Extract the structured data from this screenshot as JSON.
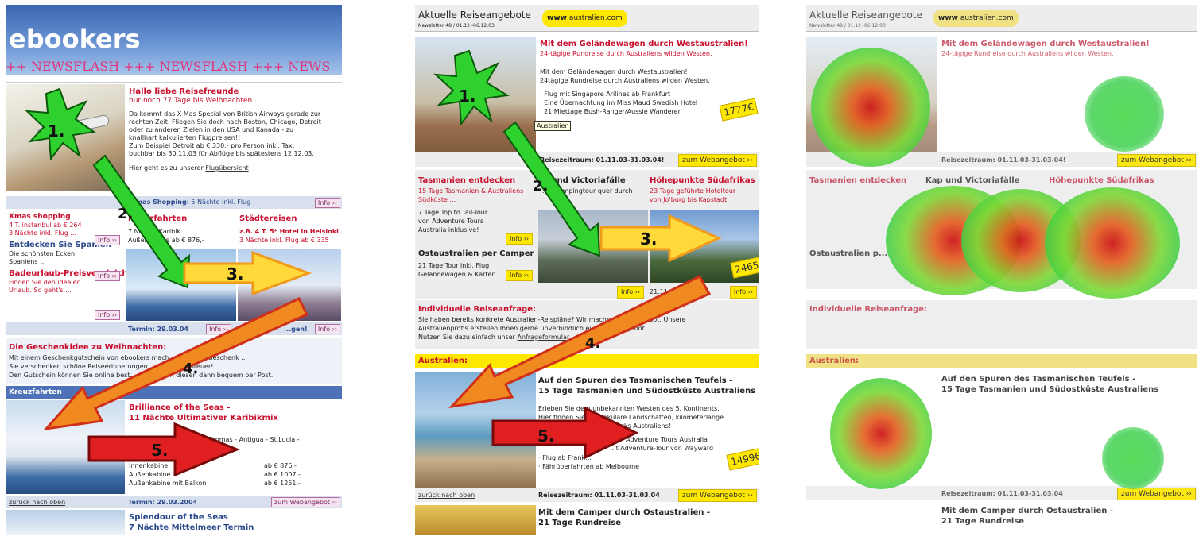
{
  "panel1": {
    "logo": "ebookers",
    "newsflash": "++ NEWSFLASH +++ NEWSFLASH +++ NEWS",
    "hero": {
      "title": "Hallo liebe Reisefreunde",
      "subtitle": "nur noch 77 Tage bis Weihnachten ...",
      "body": [
        "Da kommt das X-Mas Special von British Airways gerade zur",
        "rechten Zeit. Fliegen Sie doch nach Boston, Chicago, Detroit",
        "oder zu anderen Zielen in den USA und Kanada - zu",
        "knallhart kalkulierten Flugpreisen!!",
        "Zum Beispiel Detroit ab € 330,- pro Person inkl. Tax,",
        "buchbar bis 30.11.03 für Abflüge bis spätestens 12.12.03."
      ],
      "link_prefix": "Hier geht es zu unserer ",
      "link": "Flugübersicht"
    },
    "xmas_bar": {
      "label": "X-mas Shopping:",
      "text": " 5 Nächte inkl. Flug",
      "info": "Info ››"
    },
    "col1": [
      {
        "title": "Xmas shopping",
        "lines": [
          "4 T. instanbul ab € 264",
          "3 Nächte inkl. Flug ..."
        ],
        "info": "Info ››"
      },
      {
        "title": "Entdecken Sie Spanien",
        "lines": [
          "Die schönsten Ecken",
          "Spaniens ..."
        ],
        "info": "Info ››"
      },
      {
        "title": "Badeurlaub-Preisvergleich",
        "lines": [
          "Finden Sie den idealen",
          "Urlaub. So geht's ..."
        ],
        "info": "Info ››"
      }
    ],
    "col2": {
      "title": "Kreuzfahrten",
      "line1": "7 Nächte Karibik",
      "line2": "Außenkabine ab € 876,-"
    },
    "col3": {
      "title": "Städtereisen",
      "line1": "z.B. 4 T. 5* Hotel in Helsinki",
      "line2": "3 Nächte inkl. Flug ab € 335"
    },
    "termin_bar": {
      "termin": "Termin: 29.03.04",
      "info1": "Info ››",
      "text2": "Te...",
      "text3": "...gen!",
      "info2": "Info ››"
    },
    "gift": {
      "title": "Die Geschenkidee zu Weihnachten:",
      "lines": [
        "Mit einem Geschenkgutschein von ebookers mach... ...nur ein Geschenk ...",
        "Sie verschenken schöne Reiseerinnerungen ... ... ein Abenteuer!",
        "Den Gutschein können Sie online best... ...ersenden diesen dann bequem per Post."
      ]
    },
    "cruise_bar": "Kreuzfahrten",
    "cruise": {
      "title1": "Brilliance of the Seas -",
      "title2": "11 Nächte Ultimativer Karibikmix",
      "route": "Miami - Puerto Rico - St. Thomas - Antigua - St.Lucia -",
      "cabins": [
        {
          "name": "Innenkabine",
          "price": "ab € 876,-"
        },
        {
          "name": "Außenkabine",
          "price": "ab € 1007,-"
        },
        {
          "name": "Außenkabine mit Balkon",
          "price": "ab € 1251,-"
        }
      ]
    },
    "bottom_bar": {
      "back": "zurück nach oben",
      "termin": "Termin: 29.03.2004",
      "btn": "zum Webangebot ››"
    },
    "next": {
      "title1": "Splendour of the Seas",
      "title2": "7 Nächte Mittelmeer Termin"
    }
  },
  "panel2": {
    "header": "Aktuelle Reiseangebote",
    "newsletter": "Newsletter 48 / 01.12 -06.12.03",
    "site": "australien.com",
    "hero": {
      "title": "Mit dem Geländewagen durch Westaustralien!",
      "subtitle": "24-tägige Rundreise durch Australiens wilden Westen.",
      "body": [
        "Mit dem Geländewagen durch Westaustralien!",
        "24tägige Rundreise durch Australiens wilden Westen."
      ],
      "bullets": [
        "· Flug mit Singapore Arilines ab Frankfurt",
        "· Eine Übernachtung im Miss Maud Swedish Hotel",
        "· 21 Miettage Bush-Ranger/Aussie Wanderer"
      ],
      "price": "1777€",
      "tooltip": "Australien"
    },
    "hero_bar": {
      "period": "Reisezeitraum: 01.11.03-31.03.04!",
      "btn": "zum Webangebot ››"
    },
    "col1": {
      "title": "Tasmanien entdecken",
      "sub": [
        "15 Tage Tasmanien & Australiens",
        "Südküste ..."
      ],
      "body": [
        "7 Tage Top to Tail-Tour",
        "von Adventure Tours",
        "Australia inklusive!"
      ],
      "info": "Info ››"
    },
    "col2": {
      "title": "...und Victoriafälle",
      "sub": "...e Campingtour quer durch"
    },
    "col3": {
      "title": "Höhepunkte Südafrikas",
      "sub": [
        "23 Tage geführte Hoteltour",
        "von Jo'burg bis Kapstadt"
      ],
      "price": "2465€"
    },
    "col1b": {
      "title": "Ostaustralien per Camper",
      "lines": [
        "21 Tage Tour inkl. Flug",
        "Geländewagen & Karten ..."
      ],
      "info": "Info ››"
    },
    "midbar": {
      "info1": "Info ››",
      "date": "21.11.0...4",
      "info2": "Info ››"
    },
    "request": {
      "title": "Individuelle Reiseanfrage:",
      "lines": [
        "Sie haben bereits konkrete Australien-Reispläne? Wir machen ... ... Angebot. Unsere",
        "Australienprofis erstellen Ihnen gerne unverbindlich ei... ...eisenagebot!",
        "Nutzen Sie dazu einfach unser "
      ],
      "link": "Anfrageformular"
    },
    "aus_bar": "Australien:",
    "tas": {
      "title1": "Auf den Spuren des Tasmanischen Teufels -",
      "title2": "15 Tage Tasmanien und Südostküste Australiens",
      "body": [
        "Erleben Sie dem unbekannten Westen des 5. Kontinents.",
        "Hier finden Sie ...ektakuläre Landschaften, kilometerlange",
        "... ...schönsten Nationalparks Australiens!"
      ],
      "bullets": [
        "...on Adventure Tours Australia",
        "...t Adventure-Tour von Wayward",
        "· Flug ab Frank...",
        "· Fährüberfahrten ab Melbourne"
      ],
      "price": "1499€"
    },
    "bottom_bar": {
      "back": "zurück nach oben",
      "period": "Reisezeitraum: 01.11.03-31.03.04",
      "btn": "zum Webangebot ››"
    },
    "camper": {
      "title1": "Mit dem Camper durch Ostaustralien -",
      "title2": "21 Tage Rundreise"
    }
  },
  "panel3": {
    "header": "Aktuelle Reiseangebote",
    "newsletter": "Newsletter 48 / 01.12 -06.12.03",
    "site": "australien.com",
    "hero_title": "Mit dem Geländewagen durch Westaustralien!",
    "hero_sub": "24-tägige Rundreise durch Australiens wilden Westen.",
    "hero_bar": "Reisezeitraum: 01.11.03-31.03.04!",
    "col1": "Tasmanien entdecken",
    "col2": "Kap und Victoriafälle",
    "col3": "Höhepunkte Südafrikas",
    "col1b": "Ostaustralien p...",
    "request": "Individuelle Reiseanfrage:",
    "aus_bar": "Australien:",
    "tas_title1": "Auf den Spuren des Tasmanischen Teufels -",
    "tas_title2": "15 Tage Tasmanien und Südostküste Australiens",
    "bottom_bar": "Reisezeitraum: 01.11.03-31.03.04",
    "btn": "zum Webangebot ››",
    "camper_title1": "Mit dem Camper durch Ostaustralien -",
    "camper_title2": "21 Tage Rundreise"
  },
  "markers": [
    "1.",
    "2.",
    "3.",
    "4.",
    "5."
  ],
  "colors": {
    "brand_blue": "#2b4a8c",
    "accent_red": "#c8102e",
    "yellow": "#ffe800",
    "arrow_green": "#2fd12f",
    "arrow_orange": "#f5a623",
    "arrow_red": "#e02020"
  }
}
